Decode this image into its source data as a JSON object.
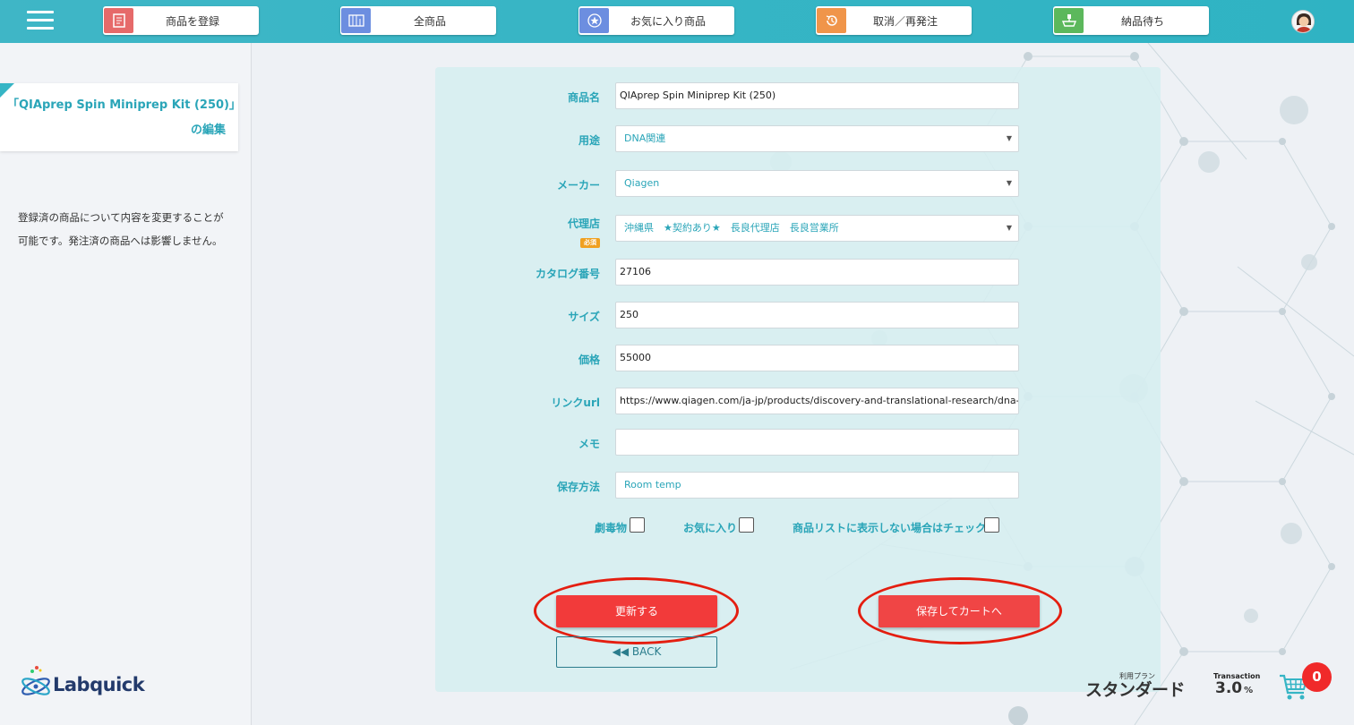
{
  "nav": {
    "items": [
      {
        "label": "商品を登録",
        "icon": "register-icon",
        "color": "#e66a6a"
      },
      {
        "label": "全商品",
        "icon": "all-products-icon",
        "color": "#6c8ee0"
      },
      {
        "label": "お気に入り商品",
        "icon": "favorite-icon",
        "color": "#6c8ee0"
      },
      {
        "label": "取消／再発注",
        "icon": "history-icon",
        "color": "#f0954a"
      },
      {
        "label": "納品待ち",
        "icon": "delivery-icon",
        "color": "#5cb85c"
      }
    ]
  },
  "sidebar": {
    "title_line1": "「QIAprep Spin Miniprep Kit (250)」",
    "title_line2": "の編集",
    "desc_line1": "登録済の商品について内容を変更することが",
    "desc_line2": "可能です。発注済の商品へは影響しません。",
    "logo_text": "Labquick"
  },
  "form": {
    "fields": [
      {
        "label": "商品名",
        "value": "QIAprep Spin Miniprep Kit (250)",
        "type": "text"
      },
      {
        "label": "用途",
        "value": "DNA関連",
        "type": "select"
      },
      {
        "label": "メーカー",
        "value": "Qiagen",
        "type": "select"
      },
      {
        "label": "代理店",
        "value": "沖縄県　★契約あり★　長良代理店　長良営業所",
        "type": "select",
        "required_badge": "必須"
      },
      {
        "label": "カタログ番号",
        "value": "27106",
        "type": "text"
      },
      {
        "label": "サイズ",
        "value": "250",
        "type": "text"
      },
      {
        "label": "価格",
        "value": "55000",
        "type": "text"
      },
      {
        "label": "リンクurl",
        "value": "https://www.qiagen.com/ja-jp/products/discovery-and-translational-research/dna-rna",
        "type": "text"
      },
      {
        "label": "メモ",
        "value": "",
        "type": "text"
      },
      {
        "label": "保存方法",
        "value": "Room temp",
        "type": "text"
      }
    ],
    "checkboxes": {
      "poison": "劇毒物",
      "favorite": "お気に入り",
      "hide": "商品リストに表示しない場合はチェック"
    },
    "update_button": "更新する",
    "save_cart_button": "保存してカートへ",
    "back_button": "◀◀ BACK"
  },
  "footer": {
    "plan_label": "利用プラン",
    "plan_name": "スタンダード",
    "transaction_label": "Transaction",
    "transaction_value": "3.0",
    "transaction_unit": "%",
    "cart_count": "0"
  }
}
